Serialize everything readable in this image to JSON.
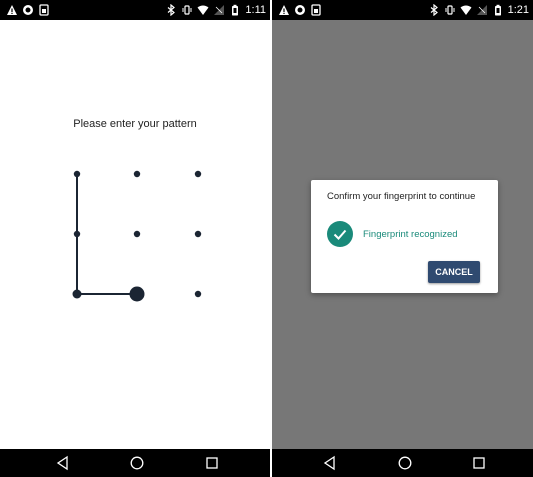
{
  "left_screen": {
    "status": {
      "left_icons": [
        "warning-icon",
        "circle-icon",
        "sim-icon"
      ],
      "right_icons": [
        "bluetooth-icon",
        "vibrate-icon",
        "wifi-icon",
        "no-signal-icon",
        "battery-icon"
      ],
      "time": "1:11"
    },
    "prompt": "Please enter your pattern",
    "pattern": {
      "grid": "3x3",
      "selected_sequence": [
        1,
        4,
        7,
        8
      ],
      "line_color": "#1b2533",
      "dot_color": "#1b2533"
    },
    "nav": [
      "back-icon",
      "home-icon",
      "recents-icon"
    ]
  },
  "right_screen": {
    "status": {
      "left_icons": [
        "warning-icon",
        "circle-icon",
        "sim-icon"
      ],
      "right_icons": [
        "bluetooth-icon",
        "vibrate-icon",
        "wifi-icon",
        "no-signal-icon",
        "battery-icon"
      ],
      "time": "1:21"
    },
    "dialog": {
      "title": "Confirm your fingerprint to continue",
      "status_text": "Fingerprint recognized",
      "cancel_label": "CANCEL"
    },
    "colors": {
      "accent": "#1a8a7a",
      "button": "#2f4a70",
      "scrim": "#777777"
    },
    "nav": [
      "back-icon",
      "home-icon",
      "recents-icon"
    ]
  }
}
